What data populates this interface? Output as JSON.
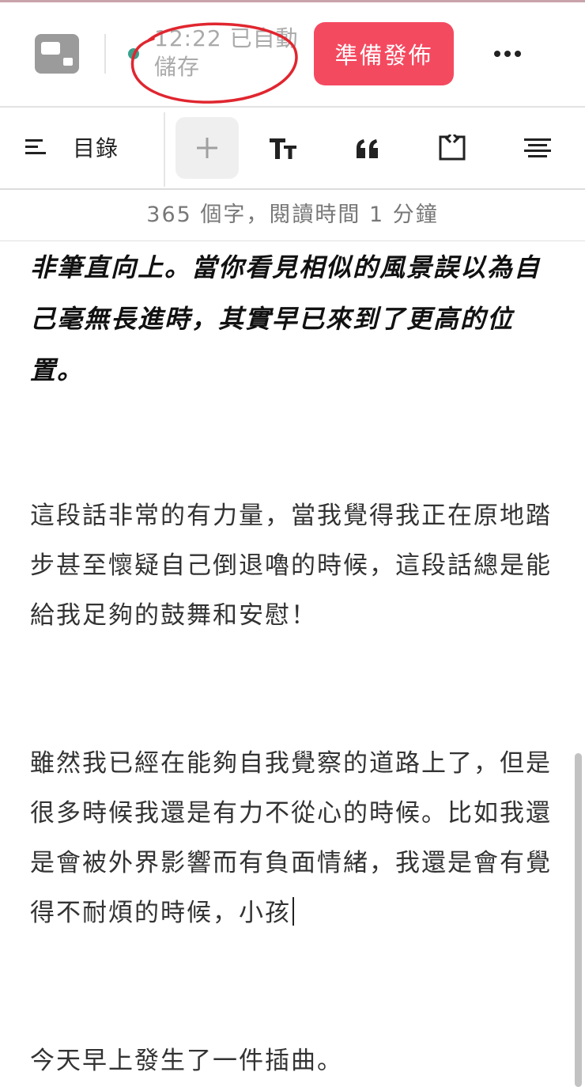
{
  "header": {
    "save_time": "12:22 已自動",
    "save_suffix": "儲存",
    "publish_label": "準備發佈"
  },
  "toolbar": {
    "toc_label": "目錄",
    "tools": [
      "add-icon",
      "text-size-icon",
      "quote-icon",
      "code-block-icon",
      "align-center-icon"
    ]
  },
  "stats": {
    "word_count_text": "365 個字，閱讀時間 1 分鐘"
  },
  "content": {
    "quote": "非筆直向上。當你看見相似的風景誤以為自己毫無長進時，其實早已來到了更高的位置。",
    "paragraphs": [
      "這段話非常的有力量，當我覺得我正在原地踏步甚至懷疑自己倒退嚕的時候，這段話總是能給我足夠的鼓舞和安慰！",
      "雖然我已經在能夠自我覺察的道路上了，但是很多時候我還是有力不從心的時候。比如我還是會被外界影響而有負面情緒，我還是會有覺得不耐煩的時候，小孩",
      "今天早上發生了一件插曲。"
    ]
  },
  "colors": {
    "accent": "#f44a60",
    "status_dot": "#3aa08d",
    "annotation": "#e0262f"
  }
}
